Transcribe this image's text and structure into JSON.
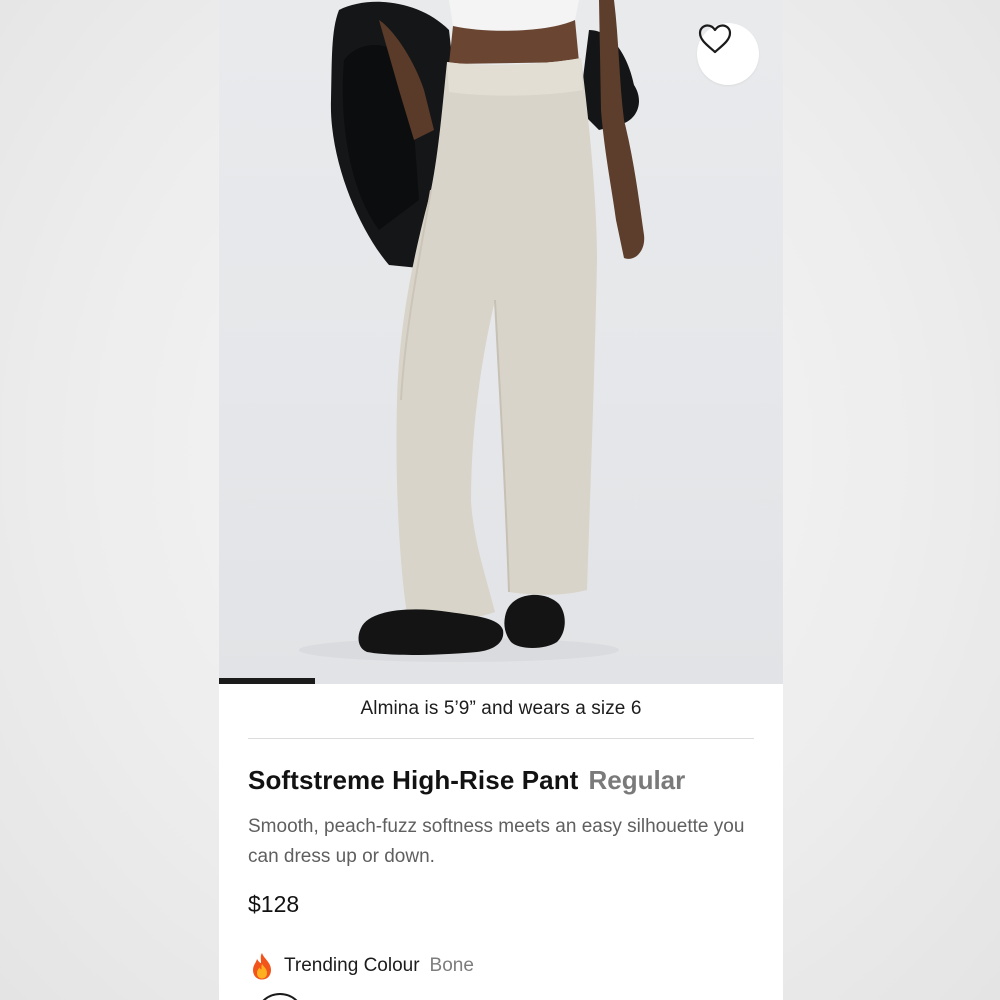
{
  "product": {
    "image_alt": "Model wearing Softstreme High-Rise Pant in Bone",
    "model_note": "Almina is 5’9” and wears a size 6",
    "name": "Softstreme High-Rise Pant",
    "fit": "Regular",
    "description": "Smooth, peach-fuzz softness meets an easy silhouette you can dress up or down.",
    "price": "$128"
  },
  "trending": {
    "icon": "fire-icon",
    "label": "Trending Colour",
    "colour": "Bone"
  },
  "gallery": {
    "progress": 0.17
  },
  "colors": {
    "page_bg": "#ededed",
    "hero_bg": "#e6e8eb",
    "pant": "#d8d3c8",
    "text_primary": "#121212",
    "text_secondary": "#7a7a7a"
  },
  "icons": {
    "favorite": "heart-outline-icon"
  }
}
